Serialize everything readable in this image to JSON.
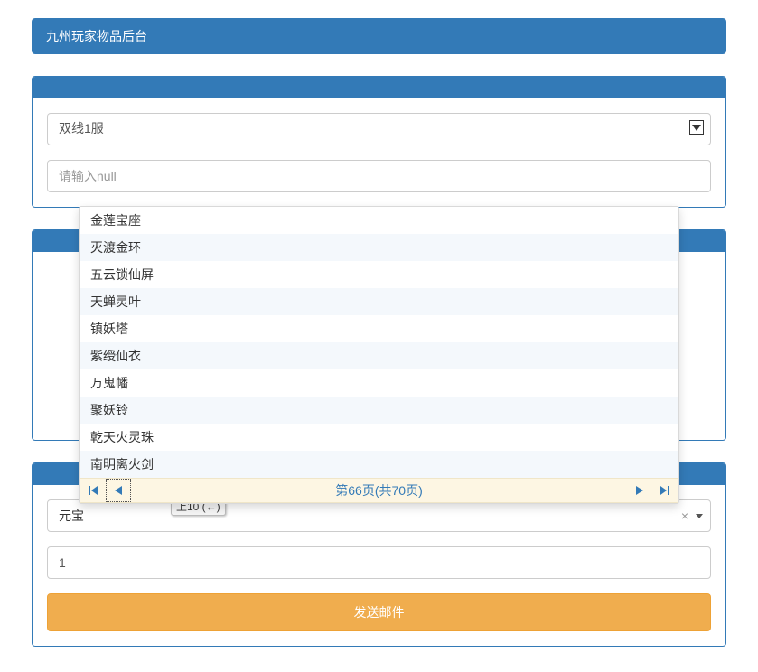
{
  "title": "九州玩家物品后台",
  "panel1": {
    "server_select": "双线1服",
    "input_placeholder": "请输入null"
  },
  "panel3": {
    "item_select": "元宝",
    "chip_text": "上10 (←)",
    "quantity_value": "1",
    "submit_label": "发送邮件"
  },
  "dropdown": {
    "items": [
      "金莲宝座",
      "灭渡金环",
      "五云锁仙屏",
      "天蝉灵叶",
      "镇妖塔",
      "紫绶仙衣",
      "万鬼幡",
      "聚妖铃",
      "乾天火灵珠",
      "南明离火剑"
    ],
    "pager_prefix": "第 ",
    "pager_current": "66",
    "pager_mid": " 页(共",
    "pager_total": "70",
    "pager_suffix": "页)"
  }
}
